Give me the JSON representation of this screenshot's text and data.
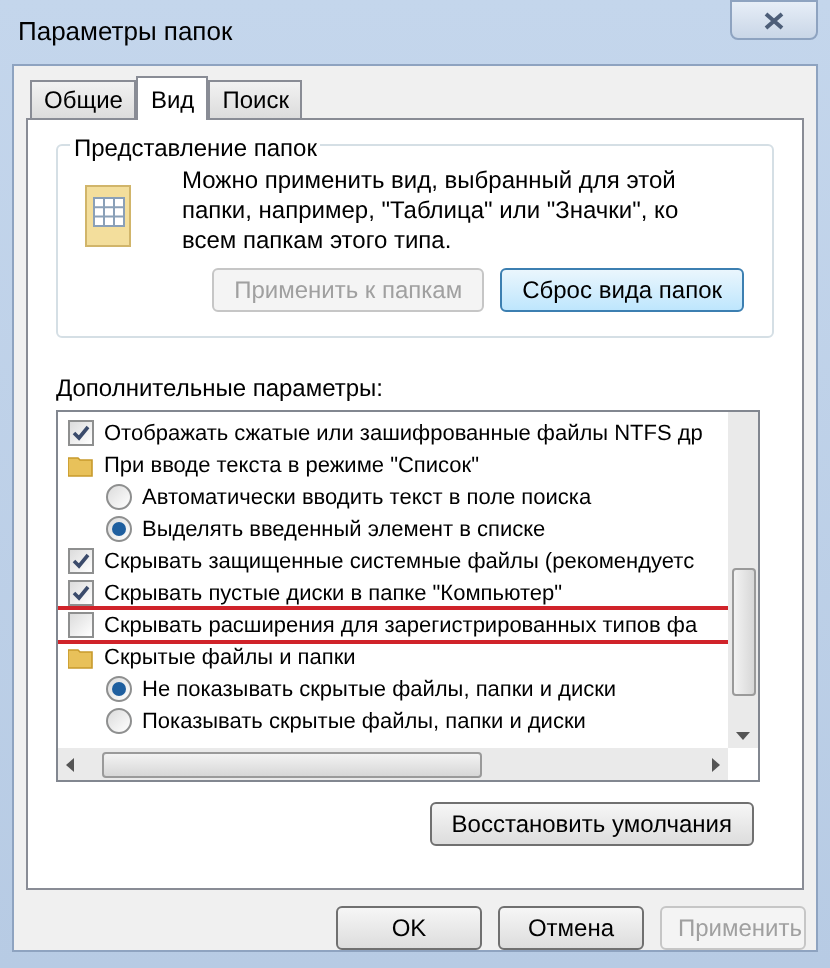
{
  "window": {
    "title": "Параметры папок"
  },
  "tabs": [
    {
      "label": "Общие",
      "selected": false
    },
    {
      "label": "Вид",
      "selected": true
    },
    {
      "label": "Поиск",
      "selected": false
    }
  ],
  "folder_views": {
    "title": "Представление папок",
    "description": "Можно применить вид, выбранный для этой папки, например, \"Таблица\" или \"Значки\", ко всем папкам этого типа.",
    "buttons": [
      {
        "label": "Применить к папкам",
        "disabled": true
      },
      {
        "label": "Сброс вида папок",
        "disabled": false
      }
    ]
  },
  "advanced": {
    "label": "Дополнительные параметры:",
    "items": [
      {
        "kind": "checkbox",
        "label": "Отображать сжатые или зашифрованные файлы NTFS др",
        "checked": true,
        "highlighted": false
      },
      {
        "kind": "folder",
        "label": "При вводе текста в режиме \"Список\"",
        "highlighted": false,
        "children": [
          {
            "kind": "radio",
            "label": "Автоматически вводить текст в поле поиска",
            "selected": false
          },
          {
            "kind": "radio",
            "label": "Выделять введенный элемент в списке",
            "selected": true
          }
        ]
      },
      {
        "kind": "checkbox",
        "label": "Скрывать защищенные системные файлы (рекомендуетс",
        "checked": true,
        "highlighted": false
      },
      {
        "kind": "checkbox",
        "label": "Скрывать пустые диски в папке \"Компьютер\"",
        "checked": true,
        "highlighted": false
      },
      {
        "kind": "checkbox",
        "label": "Скрывать расширения для зарегистрированных типов фа",
        "checked": false,
        "highlighted": true
      },
      {
        "kind": "folder",
        "label": "Скрытые файлы и папки",
        "highlighted": false,
        "children": [
          {
            "kind": "radio",
            "label": "Не показывать скрытые файлы, папки и диски",
            "selected": true
          },
          {
            "kind": "radio",
            "label": "Показывать скрытые файлы, папки и диски",
            "selected": false
          }
        ]
      }
    ]
  },
  "restore_button": {
    "label": "Восстановить умолчания",
    "disabled": false
  },
  "buttons": [
    {
      "label": "OK",
      "disabled": false
    },
    {
      "label": "Отмена",
      "disabled": false
    },
    {
      "label": "Применить",
      "disabled": true
    }
  ]
}
